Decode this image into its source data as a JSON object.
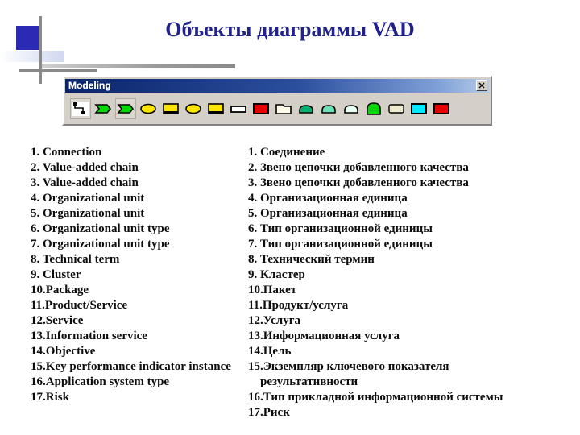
{
  "slide": {
    "title": "Объекты диаграммы VAD",
    "title_color": "#22228c",
    "background": "#ffffff",
    "bullet_square_color": "#2a2ab4"
  },
  "toolbar": {
    "window_title": "Modeling",
    "close_button_label": "close-icon",
    "titlebar_color": "#0a246a",
    "face_color": "#d4d0c8",
    "buttons": [
      {
        "index": 1,
        "name": "connection",
        "icon": "polyline-connector",
        "fill": "#ffffff",
        "stroke": "#000000",
        "framed": true
      },
      {
        "index": 2,
        "name": "value-added-chain",
        "icon": "chevron-arrow",
        "fill": "#00d900",
        "stroke": "#000000",
        "framed": false
      },
      {
        "index": 3,
        "name": "value-added-chain",
        "icon": "chevron-arrow",
        "fill": "#00d900",
        "stroke": "#000000",
        "framed": true
      },
      {
        "index": 4,
        "name": "organizational-unit",
        "icon": "ellipse",
        "fill": "#ffe400",
        "stroke": "#000000",
        "framed": false
      },
      {
        "index": 5,
        "name": "organizational-unit",
        "icon": "rect-underline",
        "fill": "#ffe400",
        "stroke": "#000000",
        "framed": false
      },
      {
        "index": 6,
        "name": "organizational-unit-type",
        "icon": "ellipse",
        "fill": "#ffe400",
        "stroke": "#000000",
        "framed": false
      },
      {
        "index": 7,
        "name": "organizational-unit-type",
        "icon": "rect-underline",
        "fill": "#ffe400",
        "stroke": "#000000",
        "framed": false
      },
      {
        "index": 8,
        "name": "technical-term",
        "icon": "rect-small",
        "fill": "#ffffff",
        "stroke": "#000000",
        "framed": false
      },
      {
        "index": 9,
        "name": "cluster",
        "icon": "rect",
        "fill": "#e60000",
        "stroke": "#000000",
        "framed": false
      },
      {
        "index": 10,
        "name": "package",
        "icon": "folder",
        "fill": "#fffbe8",
        "stroke": "#000000",
        "framed": false
      },
      {
        "index": 11,
        "name": "product-service",
        "icon": "dome",
        "fill": "#00b070",
        "stroke": "#000000",
        "framed": false
      },
      {
        "index": 12,
        "name": "service",
        "icon": "dome",
        "fill": "#6ee0b8",
        "stroke": "#000000",
        "framed": false
      },
      {
        "index": 13,
        "name": "information-service",
        "icon": "dome",
        "fill": "#e8fff4",
        "stroke": "#000000",
        "framed": false
      },
      {
        "index": 14,
        "name": "objective",
        "icon": "tall-dome",
        "fill": "#00d900",
        "stroke": "#000000",
        "framed": false
      },
      {
        "index": 15,
        "name": "key-performance-indicator",
        "icon": "rect-rounded",
        "fill": "#efeccd",
        "stroke": "#000000",
        "framed": false
      },
      {
        "index": 16,
        "name": "application-system-type",
        "icon": "rect",
        "fill": "#00eaff",
        "stroke": "#000000",
        "framed": false
      },
      {
        "index": 17,
        "name": "risk",
        "icon": "rect",
        "fill": "#e60000",
        "stroke": "#000000",
        "framed": false
      }
    ]
  },
  "legend": {
    "english": [
      "1. Connection",
      "2. Value-added chain",
      "3. Value-added chain",
      "4. Organizational unit",
      "5. Organizational unit",
      "6. Organizational unit type",
      "7. Organizational unit type",
      "8. Technical term",
      "9. Cluster",
      "10.Package",
      "11.Product/Service",
      "12.Service",
      "13.Information service",
      "14.Objective",
      "15.Key performance indicator instance",
      "16.Application system type",
      "17.Risk"
    ],
    "russian": [
      "1. Соединение",
      "2. Звено цепочки добавленного качества",
      "3. Звено цепочки добавленного качества",
      "4. Организационная единица",
      "5. Организационная единица",
      "6. Тип организационной единицы",
      "7. Тип организационной единицы",
      "8. Технический термин",
      "9. Кластер",
      "10.Пакет",
      "11.Продукт/услуга",
      "12.Услуга",
      "13.Информационная услуга",
      "14.Цель",
      "15.Экземпляр ключевого показателя",
      "результативности",
      "16.Тип прикладной информационной системы",
      "17.Риск"
    ]
  }
}
